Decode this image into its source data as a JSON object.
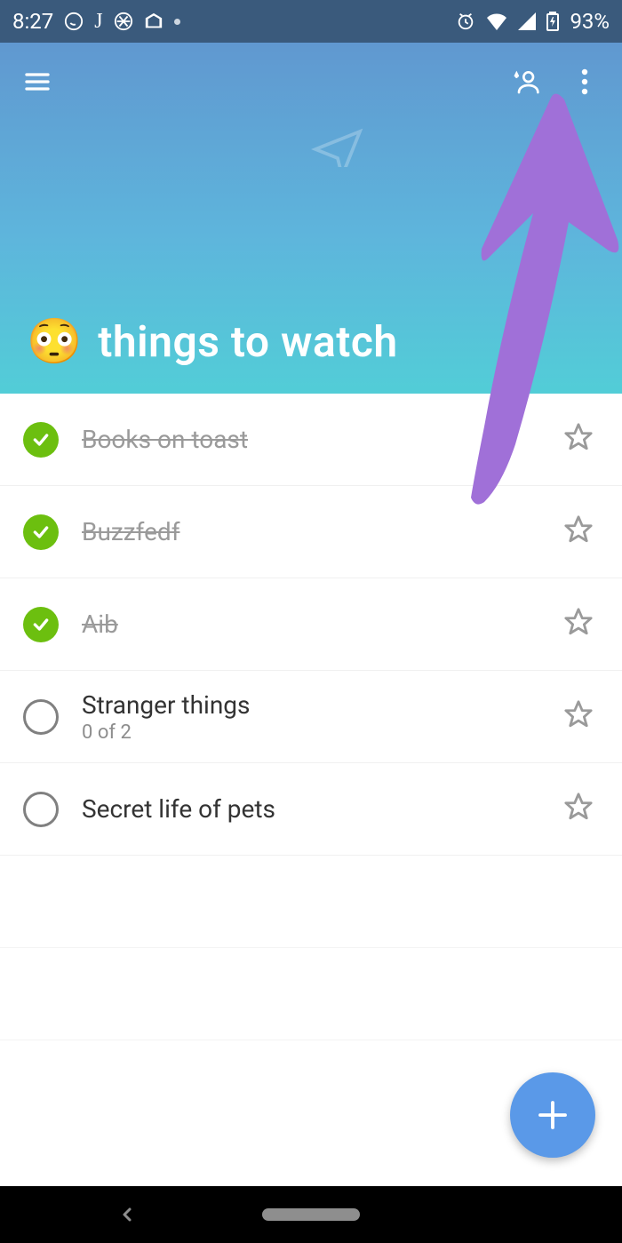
{
  "status": {
    "time": "8:27",
    "battery": "93%"
  },
  "header": {
    "emoji": "😳",
    "title": "things to watch"
  },
  "tasks": [
    {
      "label": "Books on toast",
      "completed": true,
      "starred": false,
      "subtitle": ""
    },
    {
      "label": "Buzzfedf",
      "completed": true,
      "starred": false,
      "subtitle": ""
    },
    {
      "label": "Aib",
      "completed": true,
      "starred": false,
      "subtitle": ""
    },
    {
      "label": "Stranger things",
      "completed": false,
      "starred": false,
      "subtitle": "0 of 2"
    },
    {
      "label": "Secret life of pets",
      "completed": false,
      "starred": false,
      "subtitle": ""
    }
  ]
}
